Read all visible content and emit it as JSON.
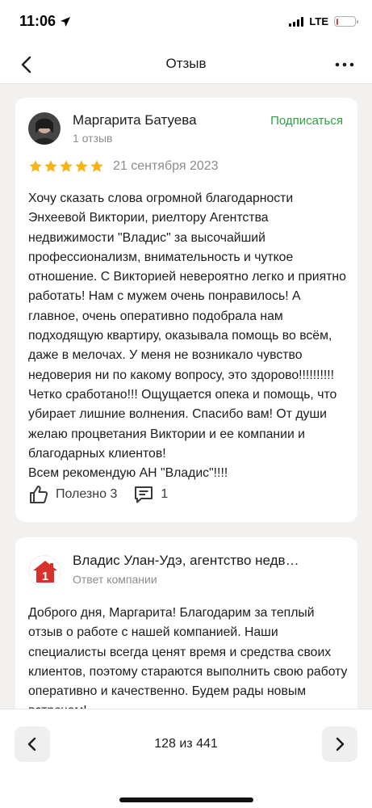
{
  "status_bar": {
    "time": "11:06",
    "network": "LTE",
    "battery_level": 0.1,
    "battery_color": "#e5403a"
  },
  "nav": {
    "title": "Отзыв",
    "back_icon": "chevron-left-icon",
    "more_icon": "more-horizontal-icon"
  },
  "review": {
    "author": "Маргарита Батуева",
    "author_meta": "1 отзыв",
    "subscribe_label": "Подписаться",
    "subscribe_color": "#2f9e44",
    "rating": 5,
    "rating_max": 5,
    "star_color": "#f4b41a",
    "date": "21 сентября 2023",
    "text": "Хочу сказать слова огромной благодарности Энхеевой Виктории, риелтору Агентства недвижимости \"Владис\" за высочайший профессионализм, внимательность и чуткое отношение. С Викторией невероятно легко и приятно работать! Нам с мужем очень понравилось! А главное, очень оперативно подобрала нам подходящую квартиру, оказывала помощь во всём, даже в мелочах. У меня не возникало чувство недоверия ни по какому вопросу, это здорово!!!!!!!!!! Четко сработано!!! Ощущается опека и помощь, что убирает лишние волнения. Спасибо вам! От души желаю процветания Виктории и ее компании и благодарных клиентов!\nВсем рекомендую АН \"Владис\"!!!!",
    "helpful_label": "Полезно 3",
    "comments_count": "1"
  },
  "reply": {
    "company": "Владис Улан-Удэ, агентство недв…",
    "subtitle": "Ответ компании",
    "logo_color": "#d8302d",
    "logo_text": "1",
    "text": "Доброго дня, Маргарита! Благодарим за теплый отзыв о работе с нашей компанией. Наши специалисты всегда ценят время и средства своих клиентов, поэтому стараются выполнить свою работу оперативно и качественно. Будем рады новым встречам!"
  },
  "pager": {
    "label": "128 из 441"
  }
}
